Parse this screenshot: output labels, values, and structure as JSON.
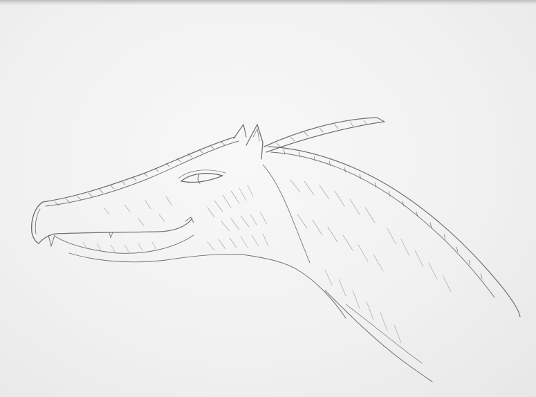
{
  "image": {
    "subject_icon": "dragon-head-sketch-icon",
    "medium": "pencil-sketch",
    "colors": {
      "paper": "#f4f4f4",
      "pencil": "#6f6f6f",
      "shading": "#a7a7a7"
    }
  }
}
